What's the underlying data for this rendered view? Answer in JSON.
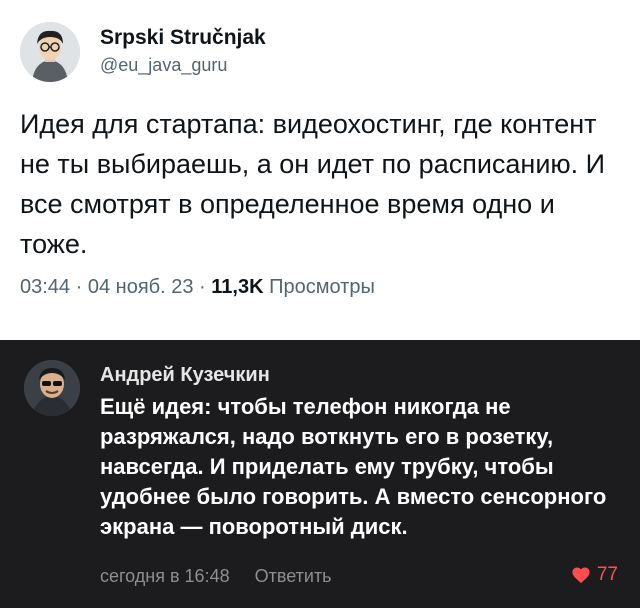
{
  "tweet": {
    "author_name": "Srpski Stručnjak",
    "author_handle": "@eu_java_guru",
    "text": "Идея для стартапа: видеохостинг, где контент не ты выбираешь, а он идет по расписанию. И все смотрят в определенное время одно и тоже.",
    "time": "03:44",
    "date": "04 нояб. 23",
    "views_count": "11,3K",
    "views_label": "Просмотры",
    "separator": "·"
  },
  "comment": {
    "author_name": "Андрей Кузечкин",
    "text": "Ещё идея: чтобы телефон никогда не разряжался, надо воткнуть его в розетку, навсегда. И приделать ему трубку, чтобы удобнее было говорить. А вместо сенсорного экрана — поворотный диск.",
    "timestamp": "сегодня в 16:48",
    "reply_label": "Ответить",
    "likes": "77",
    "like_color": "#ff4d4d"
  }
}
